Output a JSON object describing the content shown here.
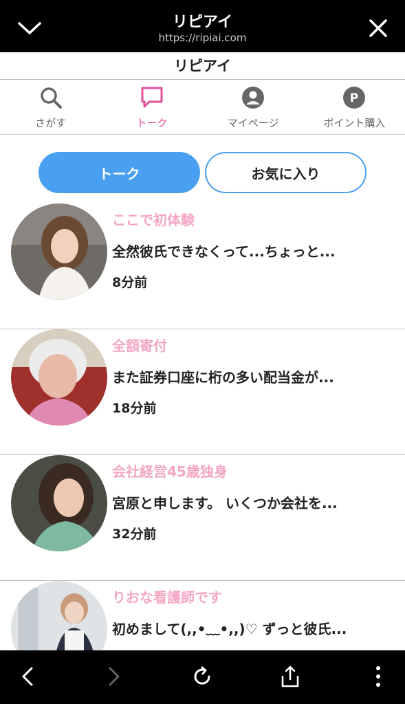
{
  "browser": {
    "title": "リピアイ",
    "url": "https://ripiai.com"
  },
  "app": {
    "title": "リピアイ"
  },
  "nav": {
    "items": [
      {
        "label": "さがす",
        "icon": "search-icon"
      },
      {
        "label": "トーク",
        "icon": "chat-icon"
      },
      {
        "label": "マイページ",
        "icon": "user-icon"
      },
      {
        "label": "ポイント購入",
        "icon": "points-icon"
      }
    ],
    "active_color": "#e64d9b"
  },
  "segment": {
    "talk_label": "トーク",
    "favorites_label": "お気に入り",
    "accent": "#4aa0f0"
  },
  "conversations": [
    {
      "name": "ここで初体験",
      "message": "全然彼氏できなくって...ちょっと...",
      "time": "8分前"
    },
    {
      "name": "全額寄付",
      "message": "また証券口座に桁の多い配当金が...",
      "time": "18分前"
    },
    {
      "name": "会社経営45歳独身",
      "message": "宮原と申します。 いくつか会社を...",
      "time": "32分前"
    },
    {
      "name": "りおな看護師です",
      "message": "初めまして(,,•﹏•,,)♡ ずっと彼氏...",
      "time": ""
    }
  ]
}
